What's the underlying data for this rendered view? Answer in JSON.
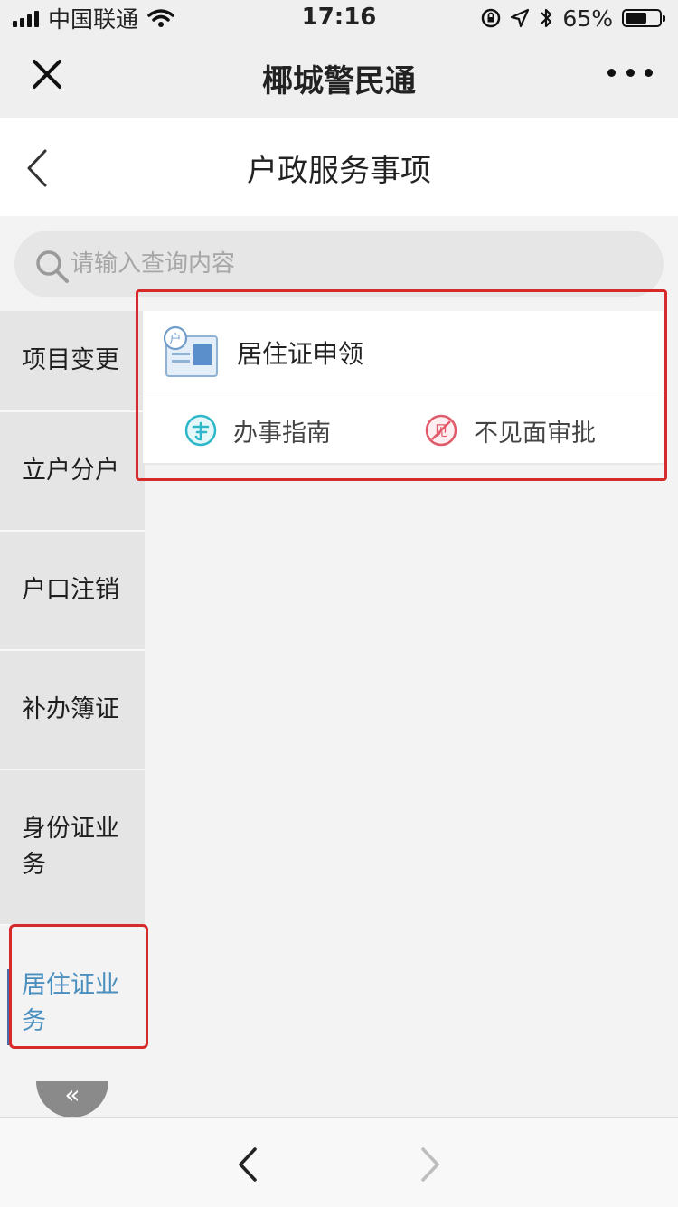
{
  "status_bar": {
    "carrier": "中国联通",
    "time": "17:16",
    "battery_percent": "65%",
    "battery_level": 0.65
  },
  "topbar": {
    "title": "椰城警民通"
  },
  "page": {
    "title": "户政服务事项"
  },
  "search": {
    "placeholder": "请输入查询内容"
  },
  "sidebar": {
    "items": [
      {
        "label": "项目变更"
      },
      {
        "label": "立户分户"
      },
      {
        "label": "户口注销"
      },
      {
        "label": "补办簿证"
      },
      {
        "label": "身份证业务"
      },
      {
        "label": "居住证业务"
      }
    ],
    "active_index": 5
  },
  "card": {
    "title": "居住证申领",
    "icon_char": "户",
    "actions": {
      "guide_label": "办事指南",
      "noface_label": "不见面审批",
      "noface_icon_char": "见"
    }
  },
  "collapse": {
    "glyph": "«"
  },
  "colors": {
    "highlight": "#d62a2a",
    "active_text": "#4a8fbe",
    "guide_icon": "#2db7c8",
    "noface_icon": "#e05a6a"
  }
}
